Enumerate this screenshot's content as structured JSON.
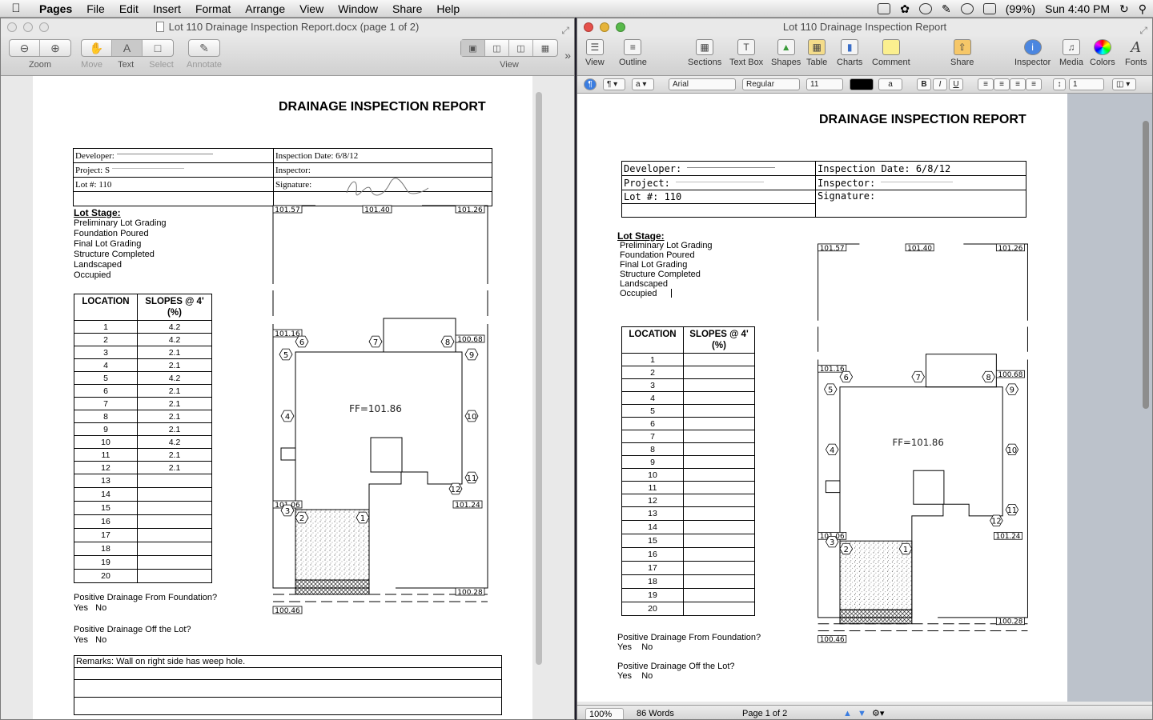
{
  "menubar": {
    "app": "Pages",
    "items": [
      "File",
      "Edit",
      "Insert",
      "Format",
      "Arrange",
      "View",
      "Window",
      "Share",
      "Help"
    ],
    "battery": "(99%)",
    "clock": "Sun 4:40 PM"
  },
  "preview": {
    "title": "Lot 110 Drainage Inspection Report.docx (page 1 of 2)",
    "toolbar": {
      "zoom_label": "Zoom",
      "move_label": "Move",
      "text_label": "Text",
      "select_label": "Select",
      "annotate_label": "Annotate",
      "view_label": "View"
    }
  },
  "pages": {
    "title": "Lot 110 Drainage Inspection Report",
    "toolbar": {
      "view": "View",
      "outline": "Outline",
      "sections": "Sections",
      "textbox": "Text Box",
      "shapes": "Shapes",
      "table": "Table",
      "charts": "Charts",
      "comment": "Comment",
      "share": "Share",
      "inspector": "Inspector",
      "media": "Media",
      "colors": "Colors",
      "fonts": "Fonts"
    },
    "format": {
      "font": "Arial",
      "style": "Regular",
      "size": "11",
      "line_spacing": "1"
    },
    "status": {
      "zoom": "100%",
      "words": "86 Words",
      "page": "Page 1 of 2"
    }
  },
  "doc": {
    "title": "DRAINAGE INSPECTION REPORT",
    "developer_label": "Developer:",
    "project_label": "Project: S",
    "project_label_r": "Project:",
    "lot_label": "Lot #: 110",
    "inspection_date": "Inspection Date: 6/8/12",
    "inspector_label": "Inspector:",
    "signature_label": "Signature:",
    "lot_stage_heading": "Lot Stage:",
    "stages": [
      "Preliminary Lot Grading",
      "Foundation Poured",
      "Final Lot Grading",
      "Structure Completed",
      "Landscaped",
      "Occupied"
    ],
    "col_location": "LOCATION",
    "col_slopes": "SLOPES @ 4'",
    "col_slopes_unit": "(%)",
    "locations": [
      "1",
      "2",
      "3",
      "4",
      "5",
      "6",
      "7",
      "8",
      "9",
      "10",
      "11",
      "12",
      "13",
      "14",
      "15",
      "16",
      "17",
      "18",
      "19",
      "20"
    ],
    "slopes": [
      "4.2",
      "4.2",
      "2.1",
      "2.1",
      "4.2",
      "2.1",
      "2.1",
      "2.1",
      "2.1",
      "4.2",
      "2.1",
      "2.1",
      "",
      "",
      "",
      "",
      "",
      "",
      "",
      ""
    ],
    "q_foundation": "Positive Drainage From Foundation?",
    "q_lot": "Positive Drainage Off the Lot?",
    "yes": "Yes",
    "no": "No",
    "remarks": "Remarks: Wall on right side has weep hole.",
    "plan": {
      "ff": "FF=101.86",
      "elev_tl": "101.57",
      "elev_tm": "101.40",
      "elev_tr": "101.26",
      "elev_ml": "101.16",
      "elev_mr": "100.68",
      "elev_bl": "101.06",
      "elev_br": "101.24",
      "elev_bot_r": "100.28",
      "elev_bot_l": "100.46",
      "points": [
        "1",
        "2",
        "3",
        "4",
        "5",
        "6",
        "7",
        "8",
        "9",
        "10",
        "11",
        "12"
      ]
    }
  }
}
